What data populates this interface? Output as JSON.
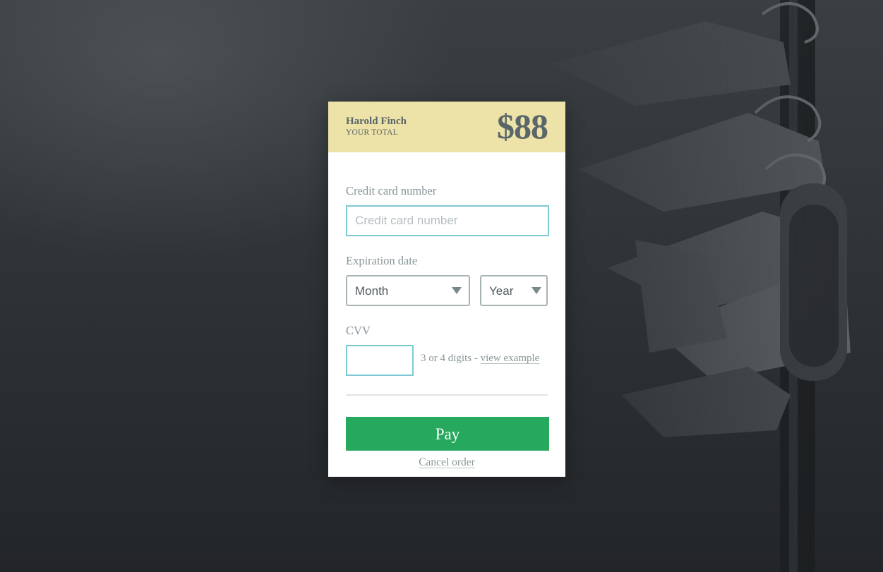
{
  "order": {
    "customer_name": "Harold Finch",
    "total_label": "YOUR TOTAL",
    "amount": "$88"
  },
  "form": {
    "card_number": {
      "label": "Credit card number",
      "placeholder": "Credit card number",
      "value": ""
    },
    "expiration": {
      "label": "Expiration date",
      "month_selected": "Month",
      "year_selected": "Year"
    },
    "cvv": {
      "label": "CVV",
      "value": "",
      "hint_text": "3 or 4 digits - ",
      "example_link": "view example"
    }
  },
  "actions": {
    "pay_label": "Pay",
    "cancel_label": "Cancel order"
  },
  "colors": {
    "header_bg": "#ede2a7",
    "pay_button": "#27a85f",
    "input_focus_border": "#7ecad4",
    "page_bg": "#2c3033"
  },
  "icons": {
    "select_caret": "caret-down-icon"
  }
}
